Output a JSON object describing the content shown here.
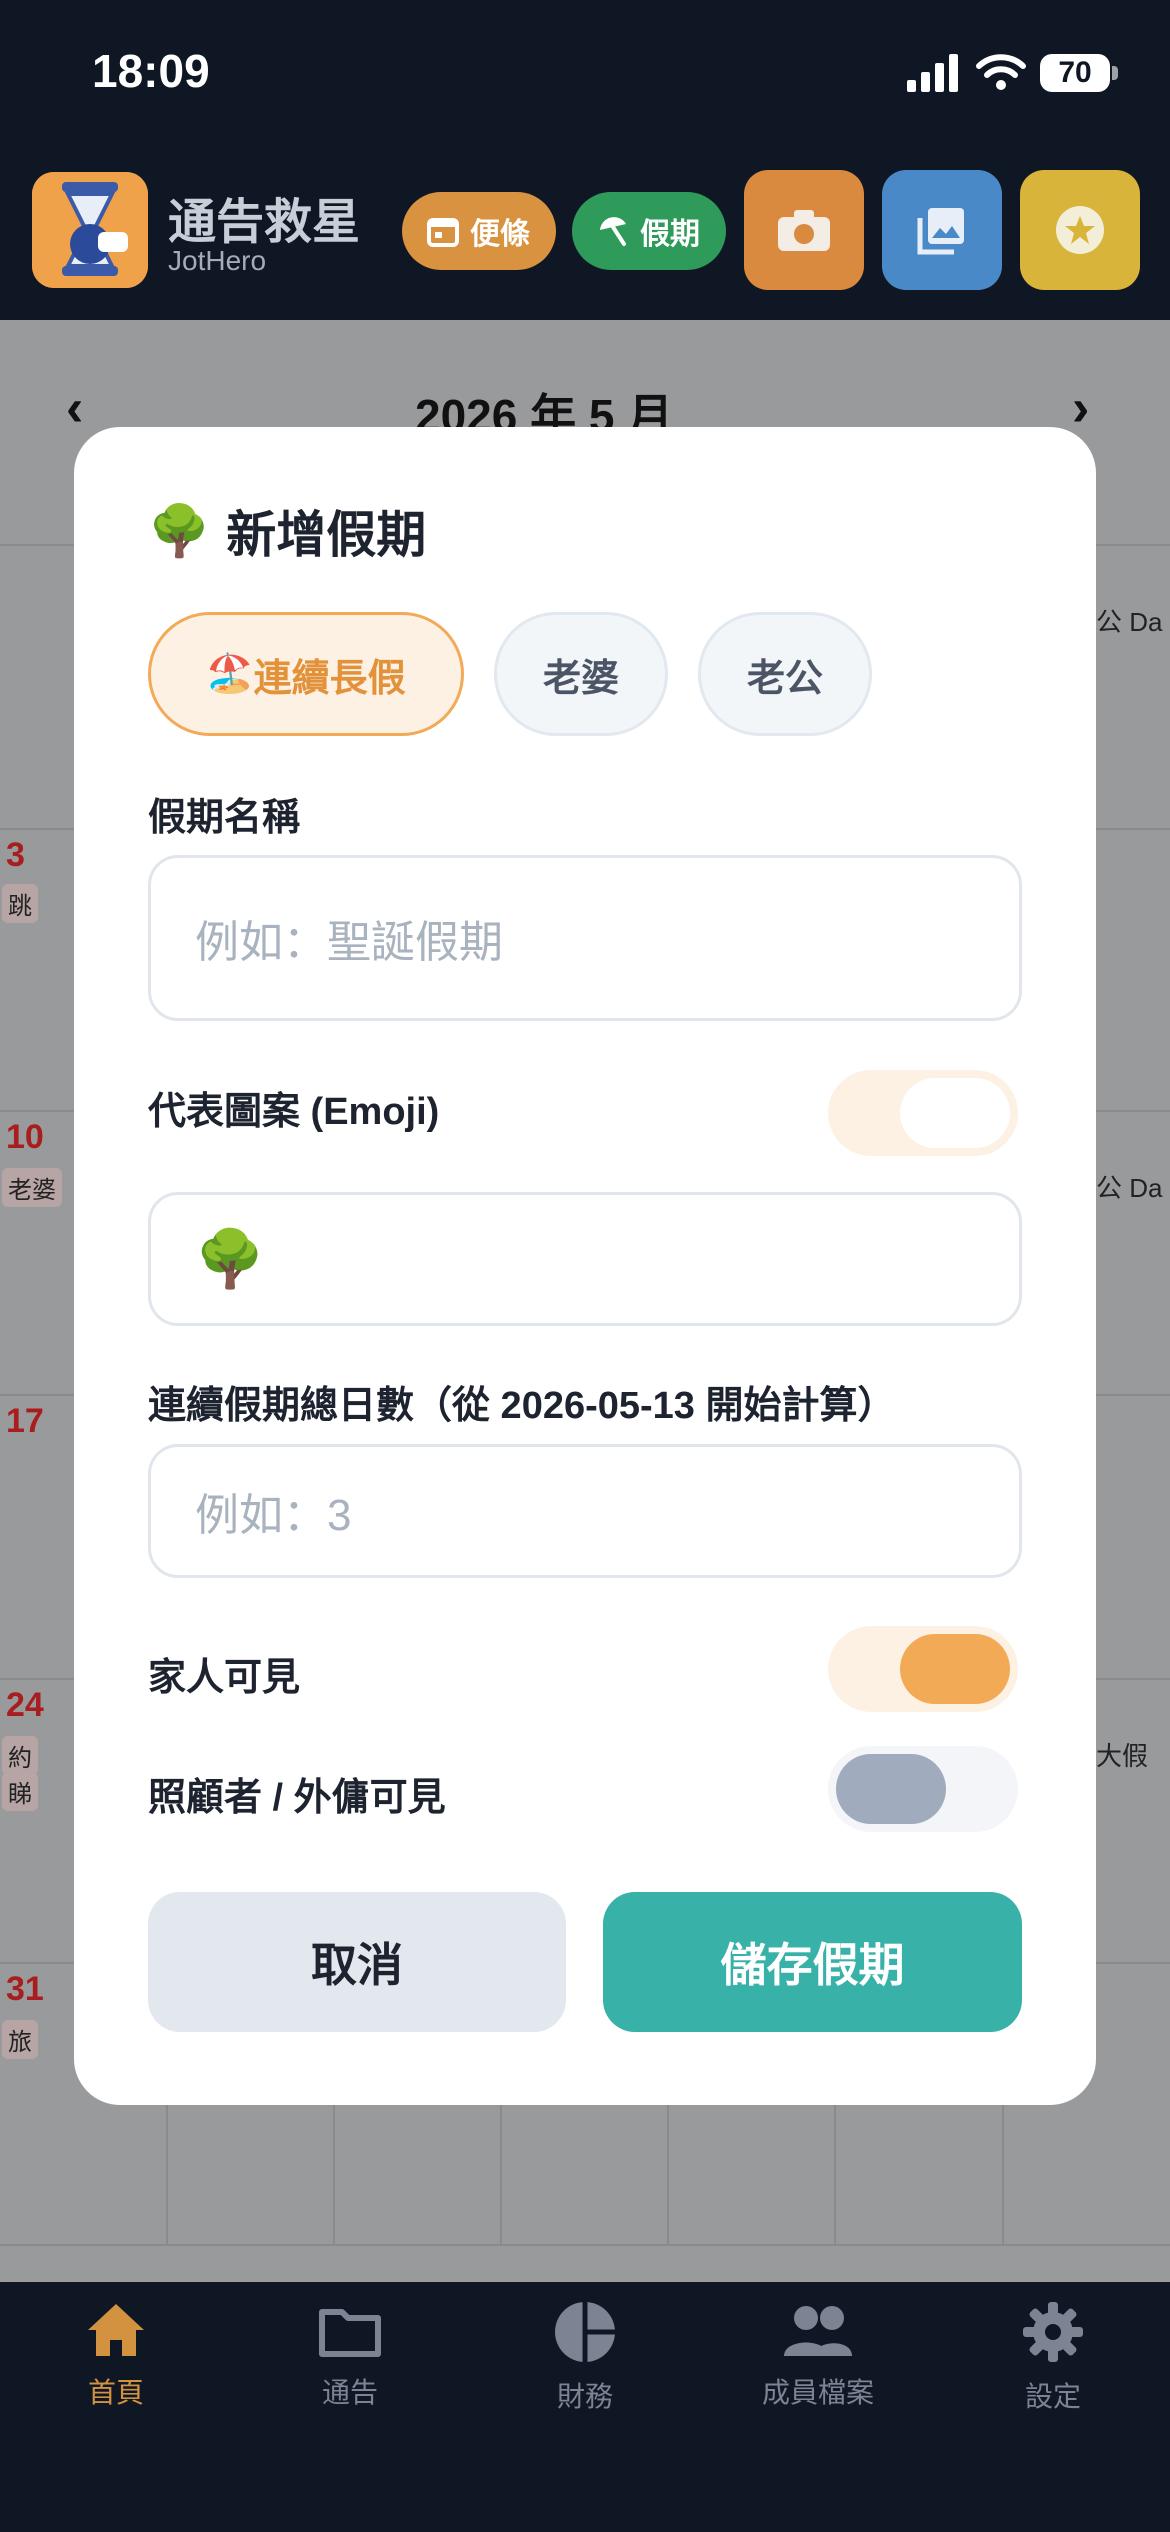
{
  "status_bar": {
    "time": "18:09",
    "battery": "70"
  },
  "header": {
    "app_title": "通告救星",
    "app_subtitle": "JotHero",
    "note_button": "便條",
    "holiday_button": "假期"
  },
  "calendar": {
    "month_label": "2026 年 5 月",
    "day_numbers": [
      "3",
      "10",
      "17",
      "24",
      "31"
    ],
    "chips": {
      "row3": "跳",
      "row10": "老婆",
      "row24a": "約",
      "row24b": "睇",
      "row31": "旅"
    },
    "right_chips": {
      "a": "公 Da",
      "b": "公 Da",
      "c": "大假"
    }
  },
  "modal": {
    "title": "新增假期",
    "title_emoji": "🌳",
    "segments": [
      {
        "emoji": "🏖️",
        "label": "連續長假",
        "selected": true
      },
      {
        "label": "老婆",
        "selected": false
      },
      {
        "label": "老公",
        "selected": false
      }
    ],
    "name_label": "假期名稱",
    "name_placeholder": "例如：聖誕假期",
    "emoji_label": "代表圖案 (Emoji)",
    "emoji_toggle_on": false,
    "emoji_value": "🌳",
    "days_label": "連續假期總日數（從 2026-05-13 開始計算）",
    "days_placeholder": "例如：3",
    "family_visible_label": "家人可見",
    "family_visible_on": true,
    "caregiver_visible_label": "照顧者 / 外傭可見",
    "caregiver_visible_on": false,
    "cancel_button": "取消",
    "save_button": "儲存假期"
  },
  "bottom_nav": [
    {
      "label": "首頁",
      "icon": "home-icon",
      "active": true
    },
    {
      "label": "通告",
      "icon": "folder-icon",
      "active": false
    },
    {
      "label": "財務",
      "icon": "pie-chart-icon",
      "active": false
    },
    {
      "label": "成員檔案",
      "icon": "people-icon",
      "active": false
    },
    {
      "label": "設定",
      "icon": "gear-icon",
      "active": false
    }
  ],
  "colors": {
    "accent_orange": "#f3aa57",
    "save_teal": "#38b2a8",
    "header_dark": "#0f1624"
  }
}
